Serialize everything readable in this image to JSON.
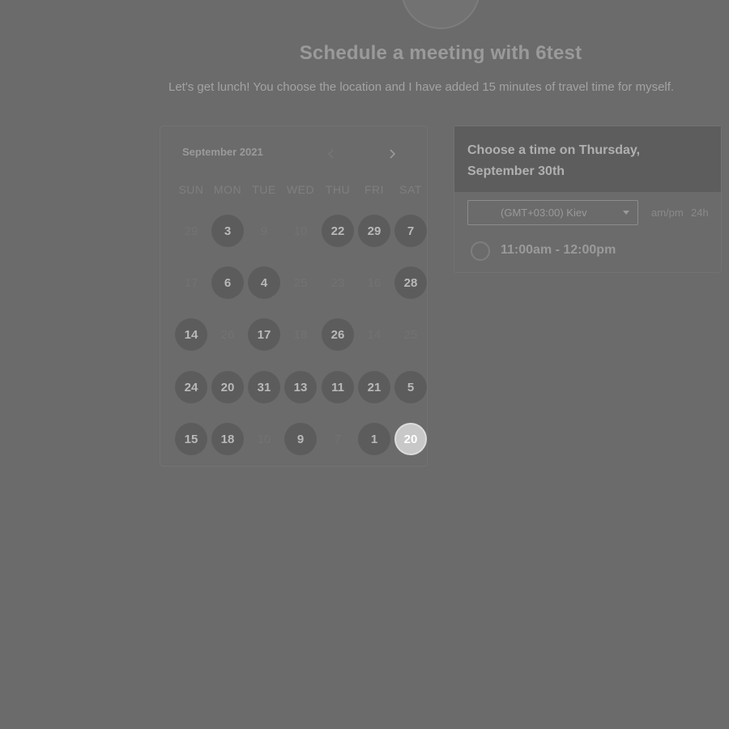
{
  "header": {
    "title": "Schedule a meeting with 6test",
    "subtitle": "Let's get lunch! You choose the location and I have added 15 minutes of travel time for myself."
  },
  "calendar": {
    "month_label": "September 2021",
    "prev_icon": "chevron-left-icon",
    "next_icon": "chevron-right-icon",
    "weekdays": [
      "SUN",
      "MON",
      "TUE",
      "WED",
      "THU",
      "FRI",
      "SAT"
    ],
    "weeks": [
      [
        {
          "label": "29",
          "available": false
        },
        {
          "label": "3",
          "available": true
        },
        {
          "label": "9",
          "available": false
        },
        {
          "label": "10",
          "available": false
        },
        {
          "label": "22",
          "available": true
        },
        {
          "label": "29",
          "available": true
        },
        {
          "label": "7",
          "available": true
        }
      ],
      [
        {
          "label": "17",
          "available": false
        },
        {
          "label": "6",
          "available": true
        },
        {
          "label": "4",
          "available": true
        },
        {
          "label": "25",
          "available": false
        },
        {
          "label": "23",
          "available": false
        },
        {
          "label": "16",
          "available": false
        },
        {
          "label": "28",
          "available": true
        }
      ],
      [
        {
          "label": "14",
          "available": true
        },
        {
          "label": "26",
          "available": false
        },
        {
          "label": "17",
          "available": true
        },
        {
          "label": "18",
          "available": false
        },
        {
          "label": "26",
          "available": true
        },
        {
          "label": "14",
          "available": false
        },
        {
          "label": "25",
          "available": false
        }
      ],
      [
        {
          "label": "24",
          "available": true
        },
        {
          "label": "20",
          "available": true
        },
        {
          "label": "31",
          "available": true
        },
        {
          "label": "13",
          "available": true
        },
        {
          "label": "11",
          "available": true
        },
        {
          "label": "21",
          "available": true
        },
        {
          "label": "5",
          "available": true
        }
      ],
      [
        {
          "label": "15",
          "available": true
        },
        {
          "label": "18",
          "available": true
        },
        {
          "label": "10",
          "available": false
        },
        {
          "label": "9",
          "available": true
        },
        {
          "label": "7",
          "available": false
        },
        {
          "label": "1",
          "available": true
        },
        {
          "label": "20",
          "available": true,
          "selected": true
        }
      ]
    ]
  },
  "time_panel": {
    "heading": "Choose a time on Thursday, September 30th",
    "timezone": "(GMT+03:00) Kiev",
    "format_ampm": "am/pm",
    "format_24h": "24h",
    "slots": [
      "11:00am - 12:00pm"
    ]
  },
  "colors": {
    "backdrop": "#6b6b6b",
    "available_day": "#5c5c5c",
    "selected_day": "#c8c8c8"
  }
}
